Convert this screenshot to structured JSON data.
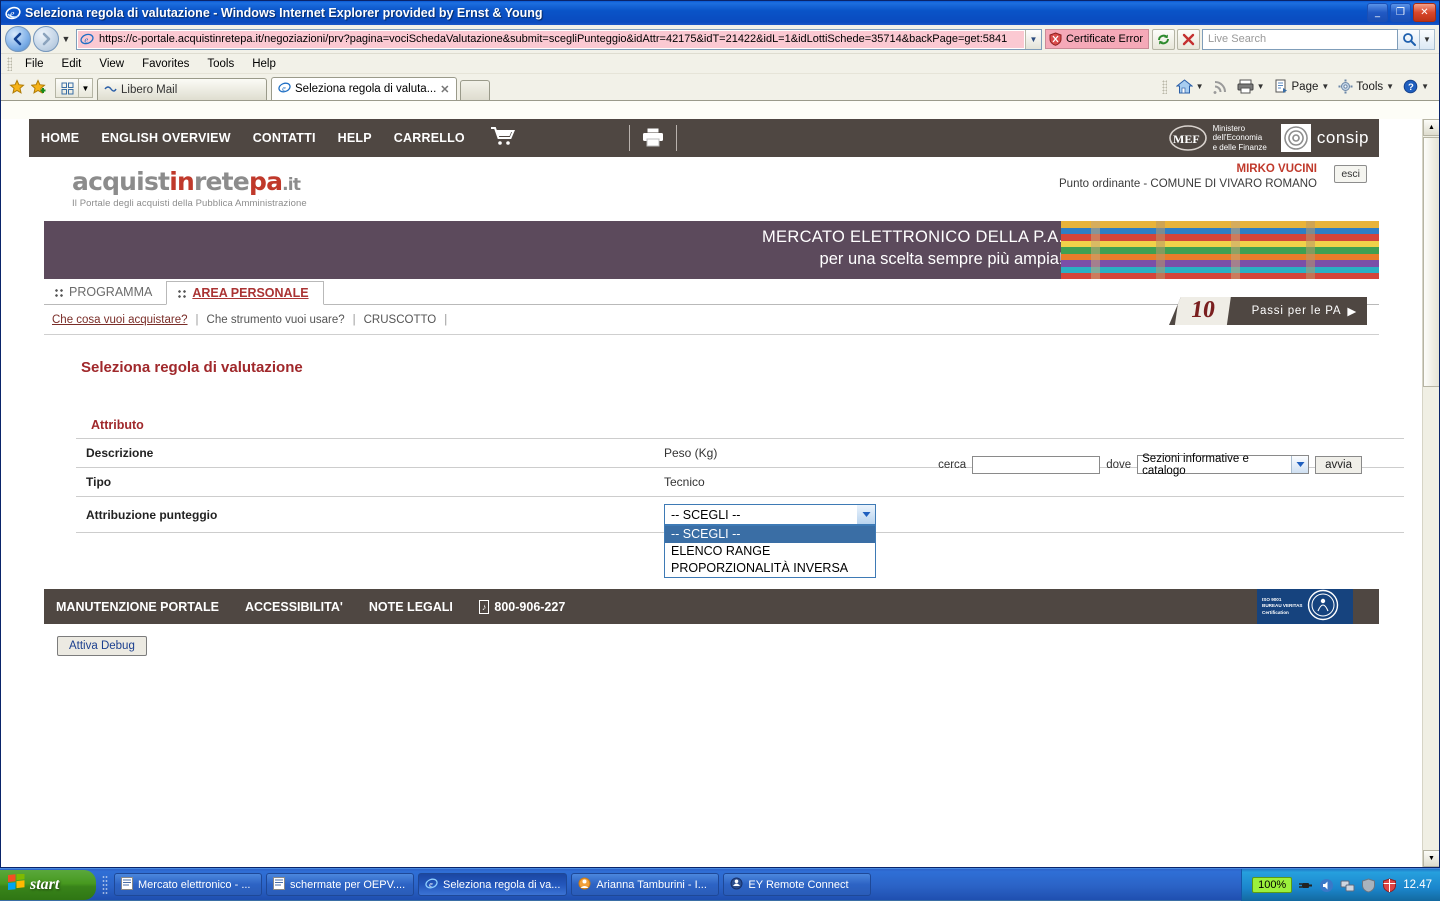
{
  "window": {
    "title": "Seleziona regola di valutazione - Windows Internet Explorer provided by Ernst & Young",
    "minimize": "_",
    "maximize": "❐",
    "close": "✕"
  },
  "address_bar": {
    "url": "https://c-portale.acquistinretepa.it/negoziazioni/prv?pagina=vociSchedaValutazione&submit=scegliPunteggio&idAttr=42175&idT=21422&idL=1&idLottiSchede=35714&backPage=get:5841",
    "certificate_error": "Certificate Error",
    "search_placeholder": "Live Search",
    "back": "◀",
    "forward": "▶",
    "refresh": "↻",
    "stop": "✕"
  },
  "menu": {
    "items": [
      "File",
      "Edit",
      "View",
      "Favorites",
      "Tools",
      "Help"
    ]
  },
  "tabs": [
    {
      "label": "Libero Mail",
      "active": false
    },
    {
      "label": "Seleziona regola di valuta...",
      "active": true
    }
  ],
  "command_bar": {
    "items": [
      "Page",
      "Tools"
    ],
    "overflow": "»"
  },
  "site": {
    "topnav": [
      "HOME",
      "ENGLISH OVERVIEW",
      "CONTATTI",
      "HELP",
      "CARRELLO"
    ],
    "logos": {
      "mef_abbr": "MEF",
      "mef_line1": "Ministero",
      "mef_line2": "dell'Economia",
      "mef_line3": "e delle Finanze",
      "consip": "consip"
    },
    "brand": {
      "part1": "acquist",
      "part2": "in",
      "part3": "rete",
      "part4": "pa",
      "suffix": ".it",
      "tagline": "Il Portale degli acquisti della Pubblica Amministrazione"
    },
    "user": {
      "name": "MIRKO VUCINI",
      "role": "Punto ordinante - COMUNE DI VIVARO ROMANO",
      "logout": "esci"
    },
    "banner": {
      "line1": "MERCATO ELETTRONICO DELLA P.A.",
      "line2": "per una scelta sempre più ampia!"
    },
    "nav_tabs": [
      {
        "label": "PROGRAMMA",
        "selected": false
      },
      {
        "label": "AREA PERSONALE",
        "selected": true
      }
    ],
    "search": {
      "label": "cerca",
      "value": "",
      "where_label": "dove",
      "scope_selected": "Sezioni informative e catalogo",
      "scope_options": [
        "Sezioni informative e catalogo"
      ],
      "submit": "avvia"
    },
    "breadcrumb": {
      "items": [
        "Che cosa vuoi acquistare?",
        "Che strumento vuoi usare?",
        "CRUSCOTTO"
      ],
      "separator": "|"
    },
    "passi": {
      "number": "10",
      "text": "Passi per le PA",
      "arrow": "▶"
    },
    "page_title": "Seleziona regola di valutazione",
    "section_title": "Attributo",
    "table": {
      "rows": [
        {
          "key": "Descrizione",
          "value": "Peso (Kg)"
        },
        {
          "key": "Tipo",
          "value": "Tecnico"
        }
      ],
      "dropdown_row_key": "Attribuzione punteggio"
    },
    "dropdown": {
      "selected": "-- SCEGLI --",
      "options": [
        "-- SCEGLI --",
        "ELENCO RANGE",
        "PROPORZIONALITÀ INVERSA"
      ],
      "highlighted_index": 0
    },
    "footer": {
      "links": [
        "MANUTENZIONE PORTALE",
        "ACCESSIBILITA'",
        "NOTE LEGALI"
      ],
      "phone": "800-906-227",
      "iso_line1": "ISO 9001",
      "iso_line2": "BUREAU VERITAS",
      "iso_line3": "Certification"
    },
    "debug_button": "Attiva Debug"
  },
  "taskbar": {
    "start": "start",
    "items": [
      {
        "label": "Mercato elettronico - ...",
        "active": false
      },
      {
        "label": "schermate per OEPV....",
        "active": false
      },
      {
        "label": "Seleziona regola di va...",
        "active": true
      },
      {
        "label": "Arianna Tamburini - I...",
        "active": false
      },
      {
        "label": "EY Remote Connect",
        "active": false
      }
    ],
    "battery": "100%",
    "clock": "12.47"
  }
}
